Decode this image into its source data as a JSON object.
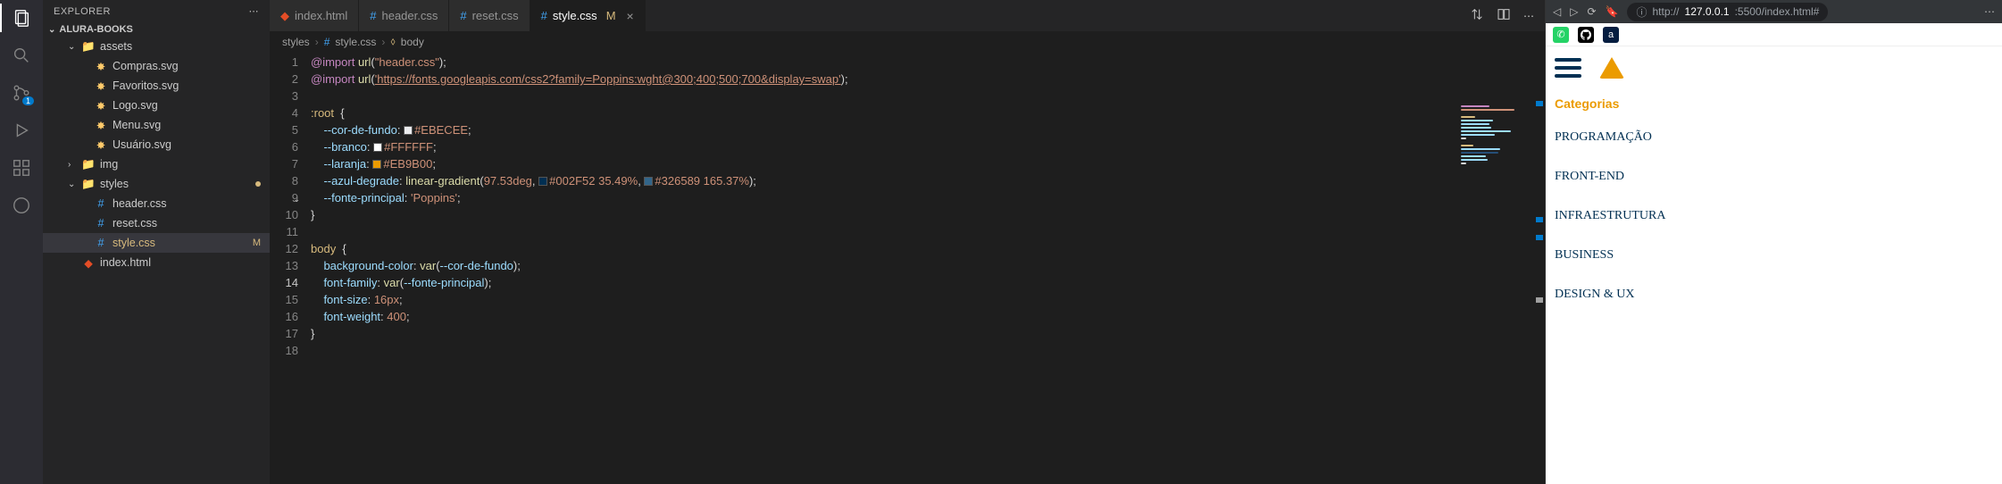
{
  "sidebar": {
    "title": "EXPLORER",
    "project": "ALURA-BOOKS",
    "tree": {
      "assets": "assets",
      "files_assets": [
        "Compras.svg",
        "Favoritos.svg",
        "Logo.svg",
        "Menu.svg",
        "Usuário.svg"
      ],
      "img": "img",
      "styles": "styles",
      "files_styles": [
        "header.css",
        "reset.css",
        "style.css"
      ],
      "root_files": [
        "index.html"
      ],
      "modified_marker": "M"
    }
  },
  "tabs": [
    {
      "icon": "html",
      "label": "index.html",
      "active": false
    },
    {
      "icon": "css",
      "label": "header.css",
      "active": false
    },
    {
      "icon": "css",
      "label": "reset.css",
      "active": false
    },
    {
      "icon": "css",
      "label": "style.css",
      "suffix": "M",
      "active": true
    }
  ],
  "breadcrumb": [
    "styles",
    "style.css",
    "body"
  ],
  "code": {
    "lines": [
      {
        "n": 1,
        "tokens": [
          {
            "t": "@import ",
            "c": "kw"
          },
          {
            "t": "url",
            "c": "fn"
          },
          {
            "t": "(",
            "c": "punc"
          },
          {
            "t": "\"header.css\"",
            "c": "str"
          },
          {
            "t": ");",
            "c": "punc"
          }
        ]
      },
      {
        "n": 2,
        "git": true,
        "tokens": [
          {
            "t": "@import ",
            "c": "kw"
          },
          {
            "t": "url",
            "c": "fn"
          },
          {
            "t": "(",
            "c": "punc"
          },
          {
            "t": "'https://fonts.googleapis.com/css2?family=Poppins:wght@300;400;500;700&display=swap'",
            "c": "str-u"
          },
          {
            "t": ");",
            "c": "punc"
          }
        ]
      },
      {
        "n": 3,
        "tokens": []
      },
      {
        "n": 4,
        "tokens": [
          {
            "t": ":root ",
            "c": "sel"
          },
          {
            "t": " {",
            "c": "punc"
          }
        ]
      },
      {
        "n": 5,
        "tokens": [
          {
            "t": "    --cor-de-fundo",
            "c": "var"
          },
          {
            "t": ": ",
            "c": "punc"
          },
          {
            "swatch": "#EBECEE"
          },
          {
            "t": "#EBECEE",
            "c": "str"
          },
          {
            "t": ";",
            "c": "punc"
          }
        ]
      },
      {
        "n": 6,
        "tokens": [
          {
            "t": "    --branco",
            "c": "var"
          },
          {
            "t": ": ",
            "c": "punc"
          },
          {
            "swatch": "#FFFFFF"
          },
          {
            "t": "#FFFFFF",
            "c": "str"
          },
          {
            "t": ";",
            "c": "punc"
          }
        ]
      },
      {
        "n": 7,
        "tokens": [
          {
            "t": "    --laranja",
            "c": "var"
          },
          {
            "t": ": ",
            "c": "punc"
          },
          {
            "swatch": "#EB9B00"
          },
          {
            "t": "#EB9B00",
            "c": "str"
          },
          {
            "t": ";",
            "c": "punc"
          }
        ]
      },
      {
        "n": 8,
        "tokens": [
          {
            "t": "    --azul-degrade",
            "c": "var"
          },
          {
            "t": ": ",
            "c": "punc"
          },
          {
            "t": "linear-gradient",
            "c": "fn"
          },
          {
            "t": "(",
            "c": "punc"
          },
          {
            "t": "97.53deg",
            "c": "str"
          },
          {
            "t": ", ",
            "c": "punc"
          },
          {
            "swatch": "#002F52"
          },
          {
            "t": "#002F52 35.49%",
            "c": "str"
          },
          {
            "t": ", ",
            "c": "punc"
          },
          {
            "swatch": "#326589"
          },
          {
            "t": "#326589 165.37%",
            "c": "str"
          },
          {
            "t": ");",
            "c": "punc"
          }
        ]
      },
      {
        "n": 9,
        "git": true,
        "fold": true,
        "tokens": [
          {
            "t": "    --fonte-principal",
            "c": "var"
          },
          {
            "t": ": ",
            "c": "punc"
          },
          {
            "t": "'Poppins'",
            "c": "str"
          },
          {
            "t": ";",
            "c": "punc"
          }
        ]
      },
      {
        "n": 10,
        "tokens": [
          {
            "t": "}",
            "c": "punc"
          }
        ]
      },
      {
        "n": 11,
        "tokens": []
      },
      {
        "n": 12,
        "tokens": [
          {
            "t": "body ",
            "c": "sel"
          },
          {
            "t": " {",
            "c": "punc"
          }
        ]
      },
      {
        "n": 13,
        "tokens": [
          {
            "t": "    background-color",
            "c": "var"
          },
          {
            "t": ": ",
            "c": "punc"
          },
          {
            "t": "var",
            "c": "fn"
          },
          {
            "t": "(",
            "c": "punc"
          },
          {
            "t": "--cor-de-fundo",
            "c": "var"
          },
          {
            "t": ");",
            "c": "punc"
          }
        ]
      },
      {
        "n": 14,
        "current": true,
        "hl": true,
        "tokens": [
          {
            "t": "    font-family",
            "c": "var"
          },
          {
            "t": ": ",
            "c": "punc"
          },
          {
            "t": "var",
            "c": "fn"
          },
          {
            "t": "(",
            "c": "punc"
          },
          {
            "t": "--fonte-principal",
            "c": "var"
          },
          {
            "t": ");",
            "c": "punc"
          }
        ]
      },
      {
        "n": 15,
        "tokens": [
          {
            "t": "    font-size",
            "c": "var"
          },
          {
            "t": ": ",
            "c": "punc"
          },
          {
            "t": "16px",
            "c": "str"
          },
          {
            "t": ";",
            "c": "punc"
          }
        ]
      },
      {
        "n": 16,
        "tokens": [
          {
            "t": "    font-weight",
            "c": "var"
          },
          {
            "t": ": ",
            "c": "punc"
          },
          {
            "t": "400",
            "c": "str"
          },
          {
            "t": ";",
            "c": "punc"
          }
        ]
      },
      {
        "n": 17,
        "tokens": [
          {
            "t": "}",
            "c": "punc"
          }
        ]
      },
      {
        "n": 18,
        "tokens": []
      }
    ]
  },
  "browser": {
    "url_prefix": "http://",
    "url_host": "127.0.0.1",
    "url_rest": ":5500/index.html#",
    "categorias_label": "Categorias",
    "menu": [
      "PROGRAMAÇÃO",
      "FRONT-END",
      "INFRAESTRUTURA",
      "BUSINESS",
      "DESIGN & UX"
    ]
  }
}
